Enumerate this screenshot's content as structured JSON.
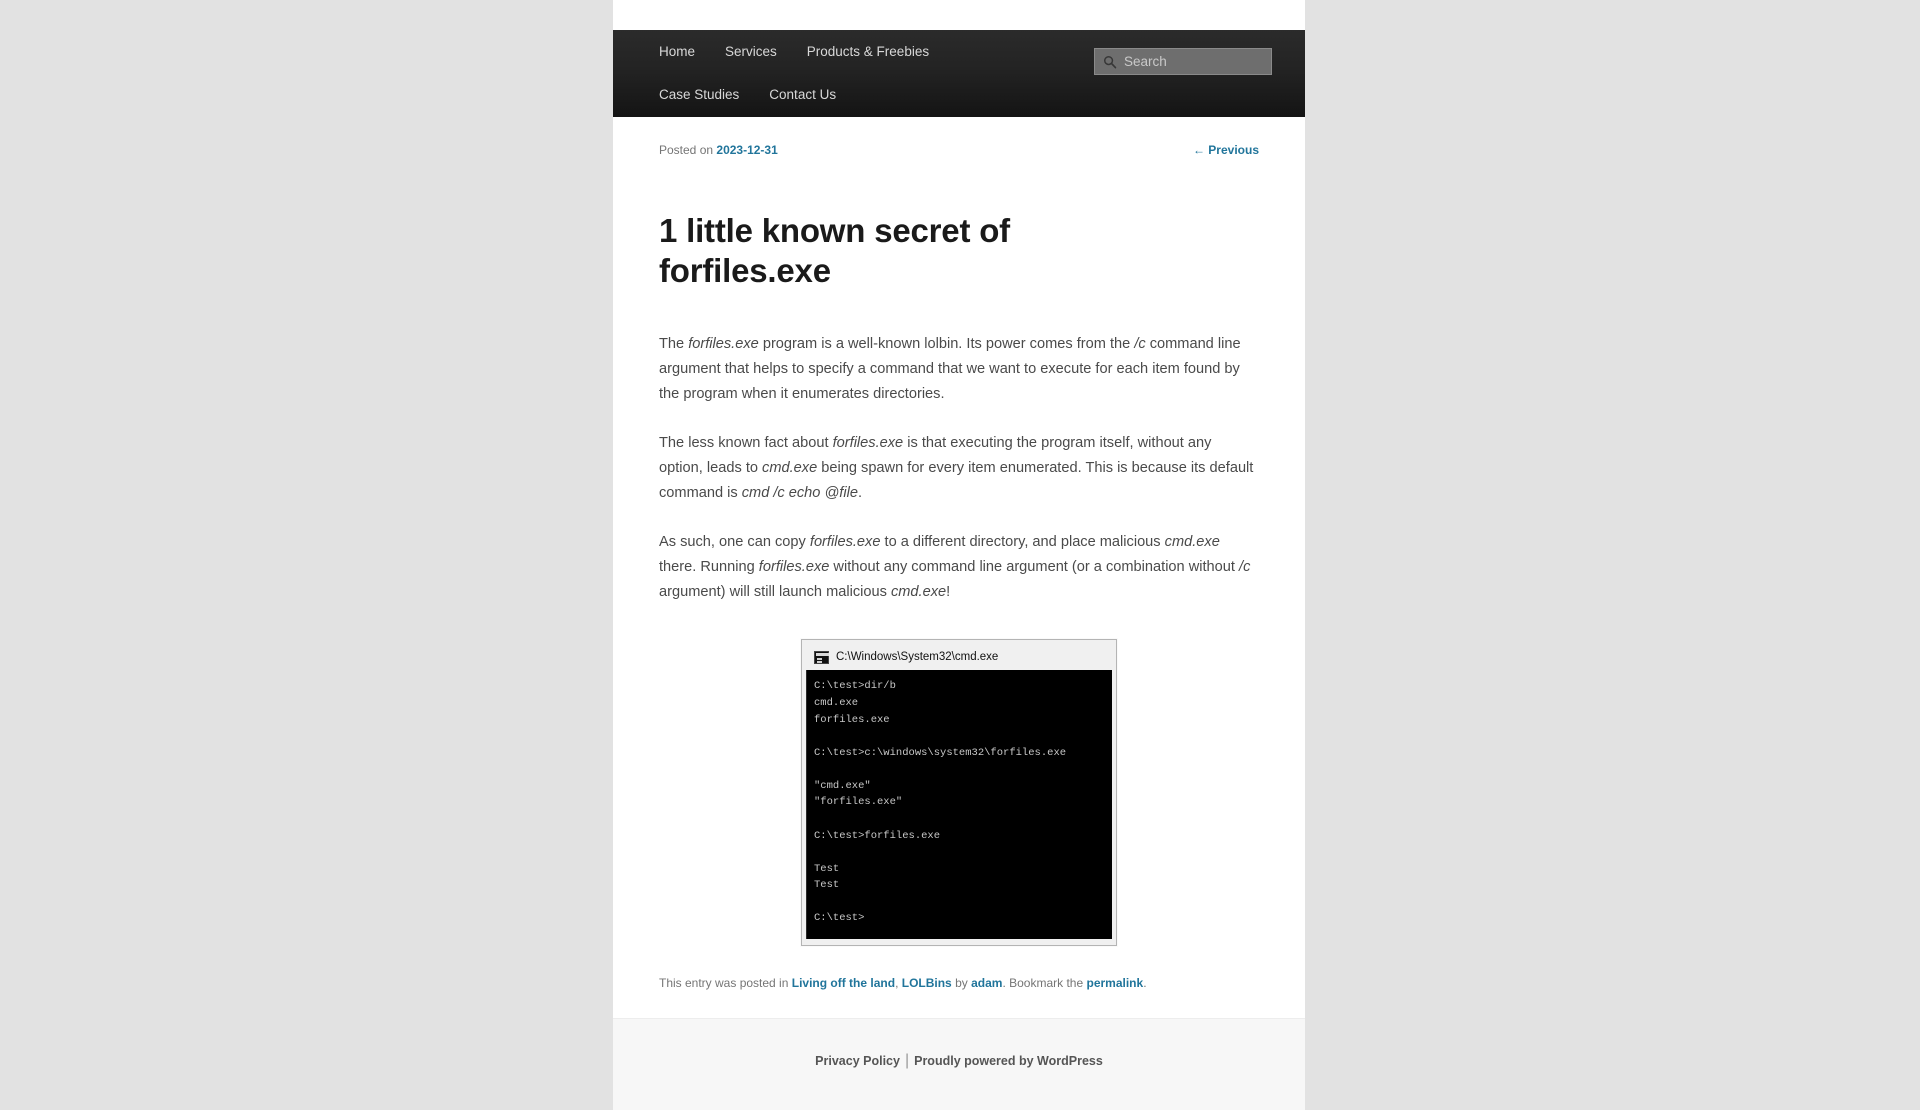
{
  "header": {
    "nav_row1": [
      {
        "label": "Home",
        "name": "nav-item-home"
      },
      {
        "label": "Services",
        "name": "nav-item-services"
      },
      {
        "label": "Products & Freebies",
        "name": "nav-item-products-freebies"
      }
    ],
    "nav_row2": [
      {
        "label": "Case Studies",
        "name": "nav-item-case-studies"
      },
      {
        "label": "Contact Us",
        "name": "nav-item-contact-us"
      }
    ],
    "search": {
      "placeholder": "Search",
      "value": "",
      "icon": "search-icon"
    }
  },
  "post": {
    "posted_on_label": "Posted on",
    "posted_date": "2023-12-31",
    "previous_link": "← Previous",
    "title": "1 little known secret of forfiles.exe",
    "paragraphs": [
      [
        {
          "t": "The ",
          "i": false
        },
        {
          "t": "forfiles.exe",
          "i": true
        },
        {
          "t": " program is a well-known lolbin. Its power comes from the ",
          "i": false
        },
        {
          "t": "/c",
          "i": true
        },
        {
          "t": " command line argument that helps to specify a command that we want to execute for each item found by the program when it enumerates directories.",
          "i": false
        }
      ],
      [
        {
          "t": "The less known fact about ",
          "i": false
        },
        {
          "t": "forfiles.exe",
          "i": true
        },
        {
          "t": " is that executing the program itself, without any option, leads to ",
          "i": false
        },
        {
          "t": "cmd.exe",
          "i": true
        },
        {
          "t": " being spawn for every item enumerated. This is because its default command is ",
          "i": false
        },
        {
          "t": "cmd /c echo @file",
          "i": true
        },
        {
          "t": ".",
          "i": false
        }
      ],
      [
        {
          "t": "As such, one can copy ",
          "i": false
        },
        {
          "t": "forfiles.exe",
          "i": true
        },
        {
          "t": " to a different directory, and place malicious ",
          "i": false
        },
        {
          "t": "cmd.exe",
          "i": true
        },
        {
          "t": " there. Running ",
          "i": false
        },
        {
          "t": "forfiles.exe",
          "i": true
        },
        {
          "t": " without any command line argument (or a combination without ",
          "i": false
        },
        {
          "t": "/c",
          "i": true
        },
        {
          "t": " argument) will still launch malicious ",
          "i": false
        },
        {
          "t": "cmd.exe",
          "i": true
        },
        {
          "t": "!",
          "i": false
        }
      ]
    ]
  },
  "terminal": {
    "title": "C:\\Windows\\System32\\cmd.exe",
    "icon": "console-window-icon",
    "lines": "C:\\test>dir/b\ncmd.exe\nforfiles.exe\n\nC:\\test>c:\\windows\\system32\\forfiles.exe\n\n\"cmd.exe\"\n\"forfiles.exe\"\n\nC:\\test>forfiles.exe\n\nTest\nTest\n\nC:\\test>"
  },
  "entry_footer": {
    "prefix": "This entry was posted in ",
    "category1": "Living off the land",
    "comma": ", ",
    "category2": "LOLBins",
    "by": " by ",
    "author": "adam",
    "bookmark": ". Bookmark the ",
    "permalink": "permalink",
    "period": "."
  },
  "site_footer": {
    "privacy": "Privacy Policy",
    "separator": "|",
    "powered_by": "Proudly powered by WordPress"
  },
  "colors": {
    "link": "#21759b",
    "page_background": "#e2e2e2",
    "header_dark": "#1f1f1f",
    "footer_background": "#f7f7f7"
  }
}
